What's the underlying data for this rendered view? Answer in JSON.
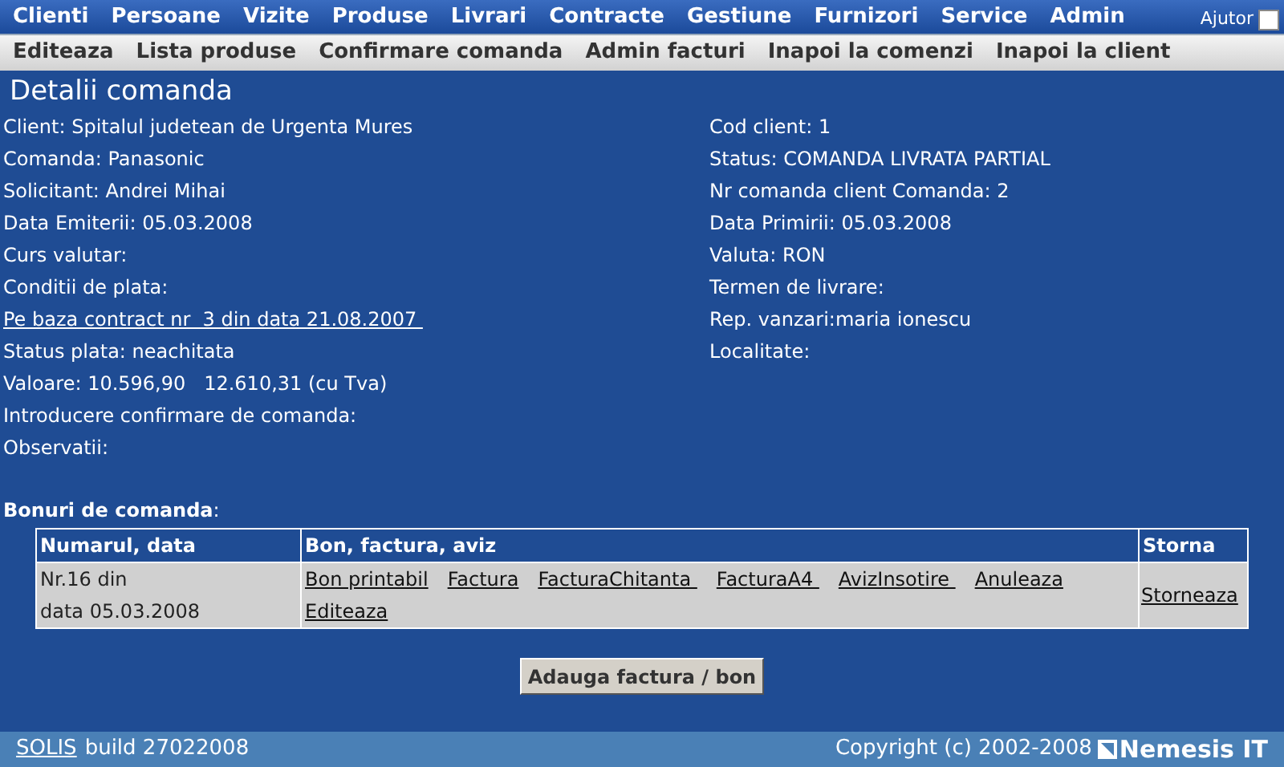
{
  "main_menu": [
    "Clienti",
    "Persoane",
    "Vizite",
    "Produse",
    "Livrari",
    "Contracte",
    "Gestiune",
    "Furnizori",
    "Service",
    "Admin"
  ],
  "help_toggle": {
    "label": "Ajutor",
    "checked": false
  },
  "sub_menu": [
    "Editeaza",
    "Lista produse",
    "Confirmare comanda",
    "Admin facturi",
    "Inapoi la comenzi",
    "Inapoi la client"
  ],
  "title": "Detalii comanda",
  "left_fields": [
    {
      "kind": "text",
      "text": "Client: Spitalul judetean de Urgenta Mures"
    },
    {
      "kind": "text",
      "text": "Comanda: Panasonic"
    },
    {
      "kind": "text",
      "text": "Solicitant: Andrei Mihai"
    },
    {
      "kind": "text",
      "text": "Data Emiterii: 05.03.2008"
    },
    {
      "kind": "text",
      "text": "Curs valutar:"
    },
    {
      "kind": "text",
      "text": "Conditii de plata:"
    },
    {
      "kind": "link",
      "text": "Pe baza contract nr  3 din data 21.08.2007 "
    },
    {
      "kind": "text",
      "text": "Status plata: neachitata"
    },
    {
      "kind": "text",
      "text": "Valoare: 10.596,90   12.610,31 (cu Tva)"
    },
    {
      "kind": "text",
      "text": "Introducere confirmare de comanda:"
    },
    {
      "kind": "text",
      "text": "Observatii:"
    }
  ],
  "right_fields": [
    "Cod client: 1",
    "Status: COMANDA LIVRATA PARTIAL",
    "Nr comanda client Comanda: 2",
    "Data Primirii: 05.03.2008",
    "Valuta: RON",
    "Termen de livrare:",
    "Rep. vanzari:maria ionescu",
    "Localitate:"
  ],
  "section_label": "**Bonuri de comanda**:",
  "table": {
    "columns": [
      "Numarul, data",
      "Bon, factura, aviz",
      "Storna"
    ],
    "rows": [
      {
        "number_lines": [
          "Nr.16 din",
          "data 05.03.2008"
        ],
        "links": [
          "Bon printabil",
          "Factura",
          "FacturaChitanta ",
          "FacturaA4 ",
          "AvizInsotire ",
          "Anuleaza",
          "Editeaza"
        ],
        "storna": "Storneaza"
      }
    ]
  },
  "add_button": "Adauga factura / bon",
  "footer": {
    "app_link": "SOLIS",
    "build": "build 27022008",
    "copyright": "Copyright (c) 2002-2008",
    "brand": "Nemesis IT"
  }
}
